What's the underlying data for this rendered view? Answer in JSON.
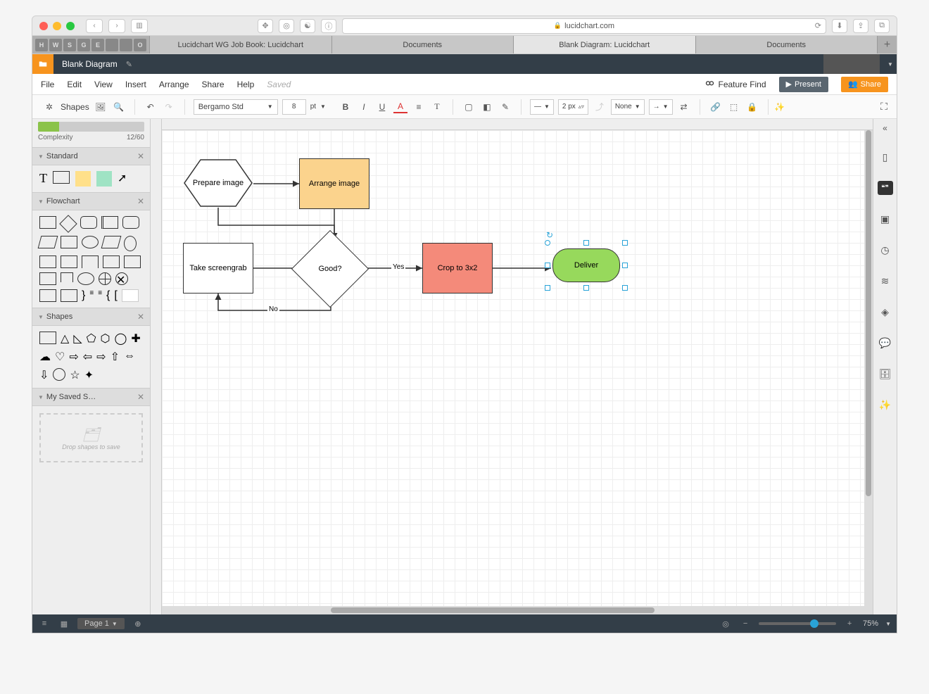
{
  "browser": {
    "url_host": "lucidchart.com",
    "fav_labels": [
      "H",
      "W",
      "S",
      "G",
      "E",
      "",
      "",
      "O"
    ],
    "tabs": [
      {
        "label": "Lucidchart WG Job Book: Lucidchart",
        "active": false
      },
      {
        "label": "Documents",
        "active": false
      },
      {
        "label": "Blank Diagram: Lucidchart",
        "active": true
      },
      {
        "label": "Documents",
        "active": false
      }
    ]
  },
  "titlebar": {
    "doc_title": "Blank Diagram"
  },
  "menubar": {
    "items": [
      "File",
      "Edit",
      "View",
      "Insert",
      "Arrange",
      "Share",
      "Help"
    ],
    "status": "Saved",
    "feature_find": "Feature Find",
    "present": "Present",
    "share": "Share"
  },
  "toolbar": {
    "shapes_label": "Shapes",
    "font_name": "Bergamo Std",
    "font_size": "8",
    "font_unit": "pt",
    "line_width": "2 px",
    "arrow_end": "None"
  },
  "left": {
    "complexity_label": "Complexity",
    "complexity_value": "12/60",
    "panels": {
      "standard": "Standard",
      "flowchart": "Flowchart",
      "shapes": "Shapes",
      "saved": "My Saved S…"
    },
    "saved_hint": "Drop shapes to save"
  },
  "flow": {
    "prepare": "Prepare image",
    "arrange": "Arrange image",
    "screengrab": "Take screengrab",
    "good": "Good?",
    "yes": "Yes",
    "no": "No",
    "crop": "Crop to 3x2",
    "deliver": "Deliver"
  },
  "status": {
    "page_label": "Page 1",
    "zoom_label": "75%"
  }
}
